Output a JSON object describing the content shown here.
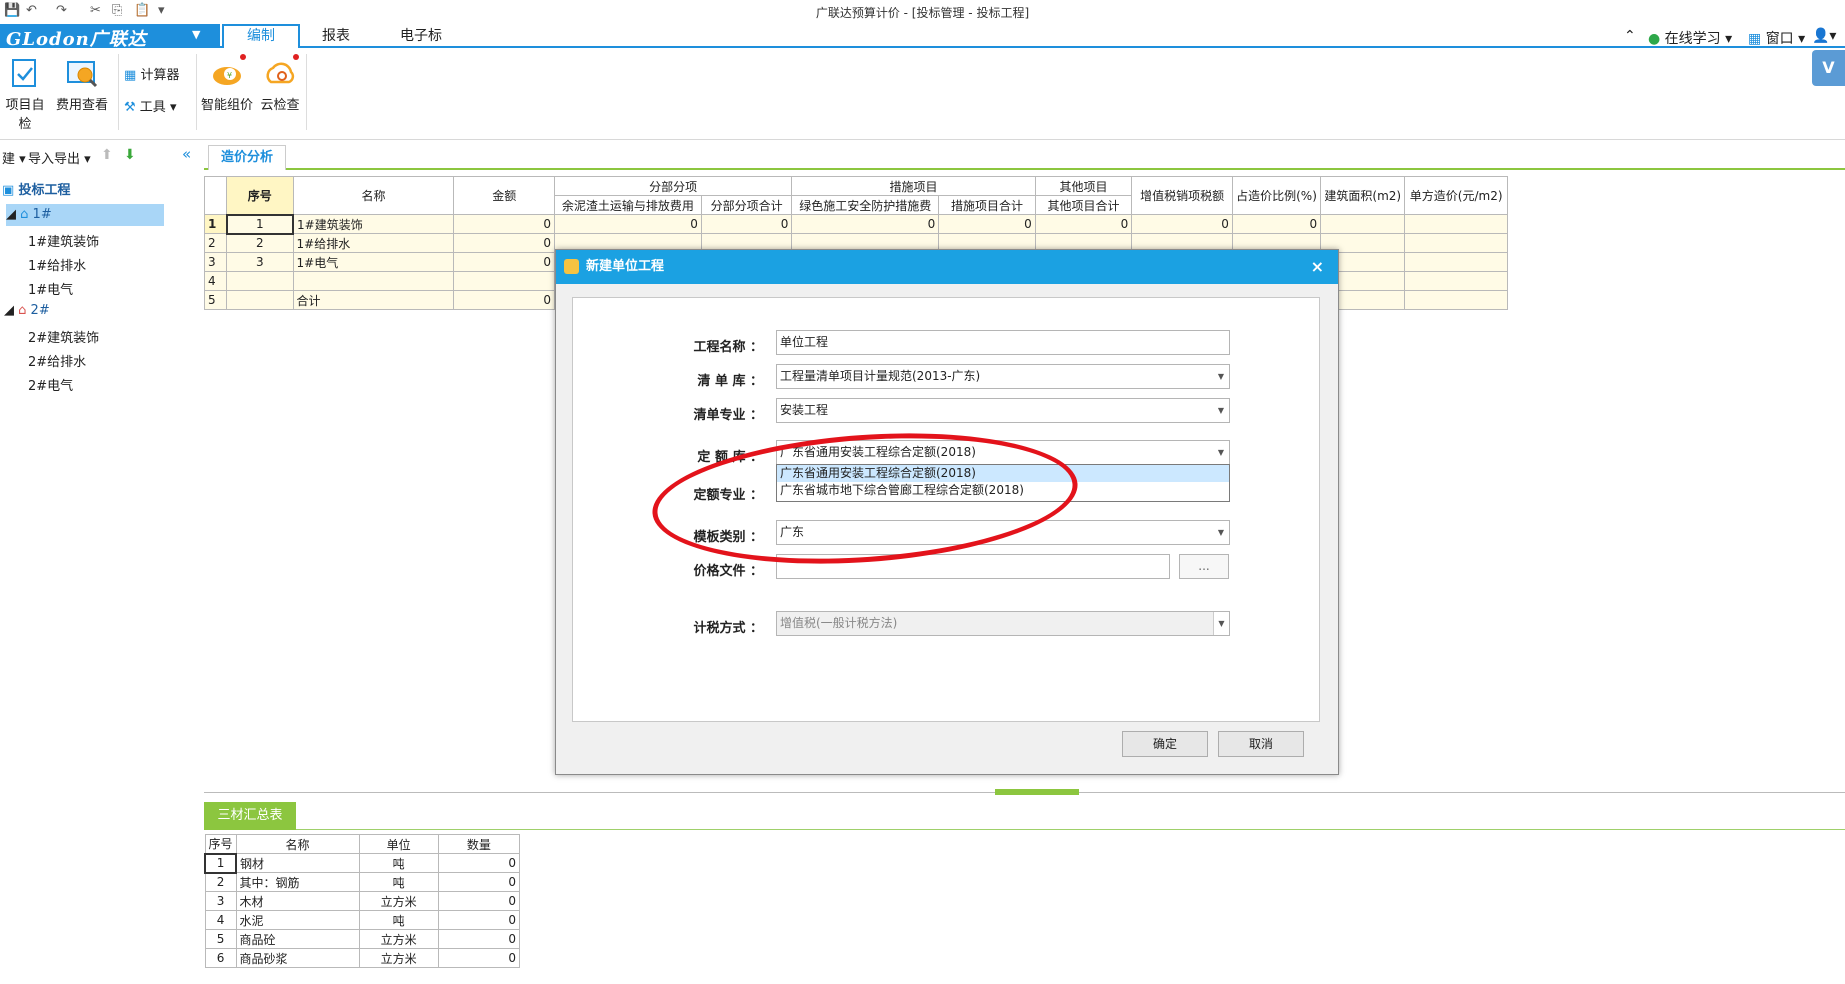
{
  "window": {
    "title": "广联达预算计价 - [投标管理 - 投标工程]"
  },
  "brand": {
    "name": "GLodon广联达"
  },
  "ribbon_tabs": [
    {
      "label": "编制"
    },
    {
      "label": "报表"
    },
    {
      "label": "电子标"
    }
  ],
  "right_menu": {
    "online_learning": "在线学习",
    "window": "窗口"
  },
  "ribbon": {
    "self_check": "项目自检",
    "fee_view": "费用查看",
    "calculator": "计算器",
    "tools": "工具",
    "smart_pricing": "智能组价",
    "cloud_check": "云检查"
  },
  "left_toolbar": {
    "new": "建",
    "import_export": "导入导出"
  },
  "tree": {
    "root": "投标工程",
    "nodes": [
      {
        "label": "1#",
        "children": [
          "1#建筑装饰",
          "1#给排水",
          "1#电气"
        ]
      },
      {
        "label": "2#",
        "children": [
          "2#建筑装饰",
          "2#给排水",
          "2#电气"
        ]
      }
    ]
  },
  "content_tab": "造价分析",
  "main_table": {
    "headers": {
      "seq": "序号",
      "name": "名称",
      "amount": "金额",
      "group_sub": "分部分项",
      "group_measure": "措施项目",
      "group_other": "其他项目",
      "vat": "增值税销项税额",
      "ratio": "占造价比例(%)",
      "area": "建筑面积(m2)",
      "unit_cost": "单方造价(元/m2)",
      "sub_a": "余泥渣土运输与排放费用",
      "sub_b": "分部分项合计",
      "measure_a": "绿色施工安全防护措施费",
      "measure_b": "措施项目合计",
      "other_a": "其他项目合计"
    },
    "rows": [
      {
        "rn": "1",
        "seq": "1",
        "name": "1#建筑装饰",
        "amount": "0",
        "c1": "0",
        "c2": "0",
        "c3": "0",
        "c4": "0",
        "c5": "0",
        "c6": "0",
        "c7": "0"
      },
      {
        "rn": "2",
        "seq": "2",
        "name": "1#给排水",
        "amount": "0"
      },
      {
        "rn": "3",
        "seq": "3",
        "name": "1#电气",
        "amount": "0"
      },
      {
        "rn": "4",
        "seq": "",
        "name": "",
        "amount": ""
      },
      {
        "rn": "5",
        "seq": "",
        "name": "合计",
        "amount": "0"
      }
    ]
  },
  "bottom_tab": "三材汇总表",
  "materials_table": {
    "headers": [
      "序号",
      "名称",
      "单位",
      "数量"
    ],
    "rows": [
      {
        "seq": "1",
        "name": "钢材",
        "unit": "吨",
        "qty": "0"
      },
      {
        "seq": "2",
        "name": "其中：钢筋",
        "unit": "吨",
        "qty": "0"
      },
      {
        "seq": "3",
        "name": "木材",
        "unit": "立方米",
        "qty": "0"
      },
      {
        "seq": "4",
        "name": "水泥",
        "unit": "吨",
        "qty": "0"
      },
      {
        "seq": "5",
        "name": "商品砼",
        "unit": "立方米",
        "qty": "0"
      },
      {
        "seq": "6",
        "name": "商品砂浆",
        "unit": "立方米",
        "qty": "0"
      }
    ]
  },
  "dialog": {
    "title": "新建单位工程",
    "close": "×",
    "labels": {
      "project_name": "工程名称 ：",
      "bill_lib": "清 单 库 ：",
      "bill_major": "清单专业 ：",
      "quota_lib": "定 额 库 ：",
      "quota_major": "定额专业 ：",
      "template": "模板类别 ：",
      "price_file": "价格文件 ：",
      "tax_method": "计税方式 ："
    },
    "values": {
      "project_name": "单位工程",
      "bill_lib": "工程量清单项目计量规范(2013-广东)",
      "bill_major": "安装工程",
      "quota_lib": "广东省通用安装工程综合定额(2018)",
      "template": "广东",
      "price_file": "",
      "tax_method": "增值税(一般计税方法)"
    },
    "quota_options": [
      "广东省通用安装工程综合定额(2018)",
      "广东省城市地下综合管廊工程综合定额(2018)"
    ],
    "browse": "...",
    "ok": "确定",
    "cancel": "取消"
  }
}
